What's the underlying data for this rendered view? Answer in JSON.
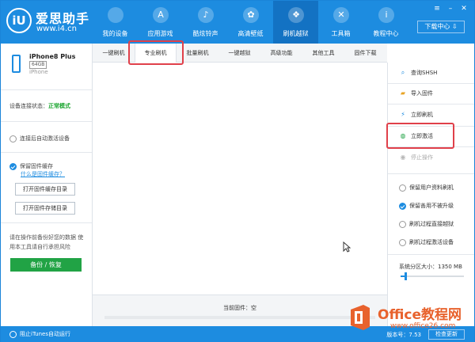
{
  "header": {
    "brand": "爱思助手",
    "url": "www.i4.cn",
    "logo_text": "iU",
    "nav": [
      {
        "label": "我的设备",
        "icon": "apple-icon",
        "glyph": ""
      },
      {
        "label": "应用游戏",
        "icon": "app-store-icon",
        "glyph": "A"
      },
      {
        "label": "酷炫铃声",
        "icon": "bell-icon",
        "glyph": "♪"
      },
      {
        "label": "高清壁纸",
        "icon": "flower-icon",
        "glyph": "✿"
      },
      {
        "label": "刷机越狱",
        "icon": "dropbox-icon",
        "glyph": "❖"
      },
      {
        "label": "工具箱",
        "icon": "tools-icon",
        "glyph": "✕"
      },
      {
        "label": "教程中心",
        "icon": "info-icon",
        "glyph": "i"
      }
    ],
    "active_nav": 4,
    "window_buttons": {
      "menu": "≡",
      "minimize": "–",
      "close": "✕"
    },
    "download_center": "下载中心 ⇩"
  },
  "device": {
    "name": "iPhone8 Plus",
    "capacity": "64GB",
    "type": "iPhone",
    "status_label": "设备连接状态：",
    "status_value": "正常模式"
  },
  "left_panel": {
    "auto_activate": "连接后自动激活设备",
    "keep_firmware": "保留固件缓存",
    "what_is_cache": "什么是固件缓存？",
    "open_cache_dir": "打开固件缓存目录",
    "open_store_dir": "打开固件存储目录",
    "tip": "请在操作前备份好您的数据 使用本工具请自行承担风险",
    "backup_button": "备份 / 恢复"
  },
  "tabs": [
    "一键刷机",
    "专业刷机",
    "批量刷机",
    "一键越狱",
    "高级功能",
    "其他工具",
    "固件下载"
  ],
  "active_tab": 1,
  "right_panel": {
    "actions": [
      {
        "label": "查询SHSH",
        "icon": "search-icon",
        "glyph": "⌕",
        "color": "#1d8ce0"
      },
      {
        "label": "导入固件",
        "icon": "folder-import-icon",
        "glyph": "▰",
        "color": "#e8a425"
      },
      {
        "label": "立即刷机",
        "icon": "lightning-icon",
        "glyph": "⚡",
        "color": "#1d8ce0"
      },
      {
        "label": "立即激活",
        "icon": "globe-icon",
        "glyph": "◍",
        "color": "#21a345"
      },
      {
        "label": "停止操作",
        "icon": "stop-icon",
        "glyph": "◉",
        "color": "#b8b8b8"
      }
    ],
    "options": [
      {
        "label": "保留用户资料刷机",
        "checked": false
      },
      {
        "label": "保留善用不被升级",
        "checked": true
      },
      {
        "label": "刷机过程直接越狱",
        "checked": false
      },
      {
        "label": "刷机过程激活设备",
        "checked": false
      }
    ],
    "system_partition_label": "系统分区大小：1350 MB",
    "system_partition_fraction": 0.07
  },
  "firmware": {
    "current_label": "当前固件：空"
  },
  "bottom": {
    "block_itunes": "阻止iTunes自动运行",
    "version": "版本号：7.53",
    "check_update": "检查更新"
  },
  "watermark": {
    "title": "Office教程网",
    "url": "www.office26.com"
  },
  "colors": {
    "primary": "#1d8ce0",
    "active_nav": "#1372c3",
    "success": "#21a345",
    "highlight": "#e0404a",
    "watermark": "#e8622d"
  }
}
